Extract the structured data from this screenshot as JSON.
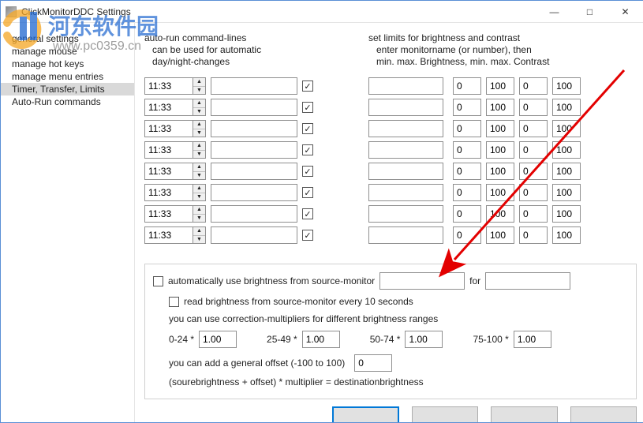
{
  "window": {
    "title": "ClickMonitorDDC   Settings"
  },
  "sidebar": {
    "items": [
      {
        "label": "general settings"
      },
      {
        "label": "manage mouse"
      },
      {
        "label": "manage hot keys"
      },
      {
        "label": "manage menu entries"
      },
      {
        "label": "Timer, Transfer, Limits",
        "selected": true
      },
      {
        "label": "Auto-Run commands"
      }
    ]
  },
  "timers": {
    "header1": "auto-run command-lines",
    "header2": "can be used for automatic",
    "header3": "day/night-changes",
    "rows": [
      {
        "time": "11:33",
        "cmd": "",
        "checked": true
      },
      {
        "time": "11:33",
        "cmd": "",
        "checked": true
      },
      {
        "time": "11:33",
        "cmd": "",
        "checked": true
      },
      {
        "time": "11:33",
        "cmd": "",
        "checked": true
      },
      {
        "time": "11:33",
        "cmd": "",
        "checked": true
      },
      {
        "time": "11:33",
        "cmd": "",
        "checked": true
      },
      {
        "time": "11:33",
        "cmd": "",
        "checked": true
      },
      {
        "time": "11:33",
        "cmd": "",
        "checked": true
      }
    ]
  },
  "limits": {
    "header1": "set limits for brightness and contrast",
    "header2": "enter monitorname (or number), then",
    "header3": "min. max. Brightness, min. max. Contrast",
    "rows": [
      {
        "monitor": "",
        "bmin": "0",
        "bmax": "100",
        "cmin": "0",
        "cmax": "100"
      },
      {
        "monitor": "",
        "bmin": "0",
        "bmax": "100",
        "cmin": "0",
        "cmax": "100"
      },
      {
        "monitor": "",
        "bmin": "0",
        "bmax": "100",
        "cmin": "0",
        "cmax": "100"
      },
      {
        "monitor": "",
        "bmin": "0",
        "bmax": "100",
        "cmin": "0",
        "cmax": "100"
      },
      {
        "monitor": "",
        "bmin": "0",
        "bmax": "100",
        "cmin": "0",
        "cmax": "100"
      },
      {
        "monitor": "",
        "bmin": "0",
        "bmax": "100",
        "cmin": "0",
        "cmax": "100"
      },
      {
        "monitor": "",
        "bmin": "0",
        "bmax": "100",
        "cmin": "0",
        "cmax": "100"
      },
      {
        "monitor": "",
        "bmin": "0",
        "bmax": "100",
        "cmin": "0",
        "cmax": "100"
      }
    ]
  },
  "transfer": {
    "auto_label": "automatically use brightness from source-monitor",
    "for_label": "for",
    "source": "",
    "dest": "",
    "read_label": "read brightness from source-monitor every 10 seconds",
    "multipliers_label": "you can use correction-multipliers for different brightness ranges",
    "ranges": [
      {
        "label": "0-24  *",
        "val": "1.00"
      },
      {
        "label": "25-49  *",
        "val": "1.00"
      },
      {
        "label": "50-74  *",
        "val": "1.00"
      },
      {
        "label": "75-100  *",
        "val": "1.00"
      }
    ],
    "offset_label": "you can add a general offset (-100 to 100)",
    "offset": "0",
    "formula": "(sourebrightness + offset) * multiplier  = destinationbrightness"
  },
  "watermark": {
    "text": "河东软件园",
    "url": "www.pc0359.cn"
  },
  "glyph": {
    "check": "✓",
    "up": "▲",
    "down": "▼",
    "minimize": "—",
    "maximize": "□",
    "close": "✕"
  }
}
